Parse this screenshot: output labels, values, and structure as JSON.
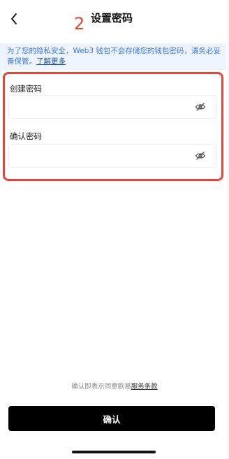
{
  "header": {
    "step_number": "2",
    "title": "设置密码",
    "back_icon": "chevron-left-icon"
  },
  "notice": {
    "text": "为了您的隐私安全，Web3 钱包不会存储您的钱包密码，请务必妥善保管。",
    "link": "了解更多"
  },
  "form": {
    "create_label": "创建密码",
    "create_value": "",
    "confirm_label": "确认密码",
    "confirm_value": "",
    "toggle_icon": "eye-off-icon"
  },
  "footer": {
    "terms_text": "确认即表示同意欧易",
    "terms_link": "服务条款",
    "confirm_button": "确认"
  },
  "colors": {
    "accent_red": "#e54638",
    "notice_text": "#3b78d8",
    "notice_bg": "#eef4fe",
    "button_bg": "#000000"
  }
}
